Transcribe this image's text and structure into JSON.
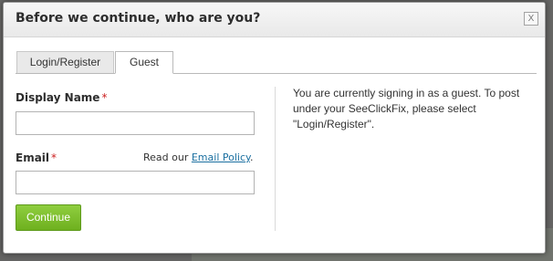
{
  "dialog": {
    "title": "Before we continue, who are you?",
    "close_label": "X"
  },
  "tabs": [
    {
      "label": "Login/Register",
      "active": false
    },
    {
      "label": "Guest",
      "active": true
    }
  ],
  "form": {
    "display_name_label": "Display Name",
    "display_name_value": "",
    "email_label": "Email",
    "email_value": "",
    "required_marker": "*",
    "policy_prefix": "Read our ",
    "policy_link": "Email Policy",
    "policy_suffix": ".",
    "continue_label": "Continue"
  },
  "guest_info": {
    "text": "You are currently signing in as a guest. To post under your SeeClickFix, please select \"Login/Register\"."
  },
  "colors": {
    "continue_button": "#7cbf2b",
    "required_marker": "#cc2222",
    "link": "#1a6fa0"
  }
}
